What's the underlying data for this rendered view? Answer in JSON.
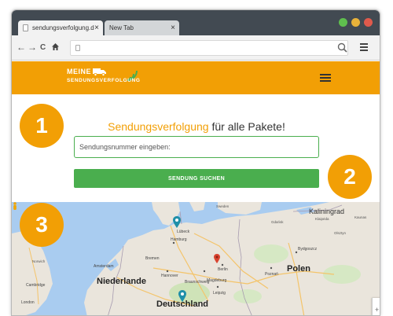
{
  "browser": {
    "tabs": [
      {
        "label": "sendungsverfolgung.de",
        "close_glyph": "×"
      },
      {
        "label": "New Tab",
        "close_glyph": "×"
      }
    ],
    "nav": {
      "back": "←",
      "forward": "→",
      "reload": "C"
    },
    "window_controls": {
      "green": "#5fbf4e",
      "yellow": "#e8b23a",
      "red": "#e05a4c"
    }
  },
  "site": {
    "logo": {
      "line1": "MEINE",
      "line2": "SENDUNGSVERFOLGUNG"
    },
    "brand_color": "#f29f05",
    "menu_icon": "hamburger-icon"
  },
  "hero": {
    "headline_accent": "Sendungsverfolgung",
    "headline_rest": " für alle Pakete!",
    "input_placeholder": "Sendungsnummer eingeben:",
    "button_label": "SENDUNG SUCHEN",
    "accent_color": "#4aae4e"
  },
  "badges": [
    "1",
    "2",
    "3"
  ],
  "map": {
    "countries": [
      "Niederlande",
      "Polen",
      "Deutschland"
    ],
    "regions": [
      "Kaliningrad"
    ],
    "cities": [
      "Hamburg",
      "Lübeck",
      "Berlin",
      "Hannover",
      "Braunschweig",
      "Magdeburg",
      "Leipzig",
      "Bydgoszcz",
      "Poznań",
      "Amsterdam",
      "Cambridge",
      "London",
      "Bremen"
    ],
    "small_labels": [
      "Klaipėda",
      "Gdańsk",
      "Olsztyn",
      "Sweden",
      "Kaunas",
      "Norwich"
    ],
    "zoom_plus": "+",
    "pin_colors": {
      "teal": "#1f8fa8",
      "red": "#d9432f"
    }
  }
}
